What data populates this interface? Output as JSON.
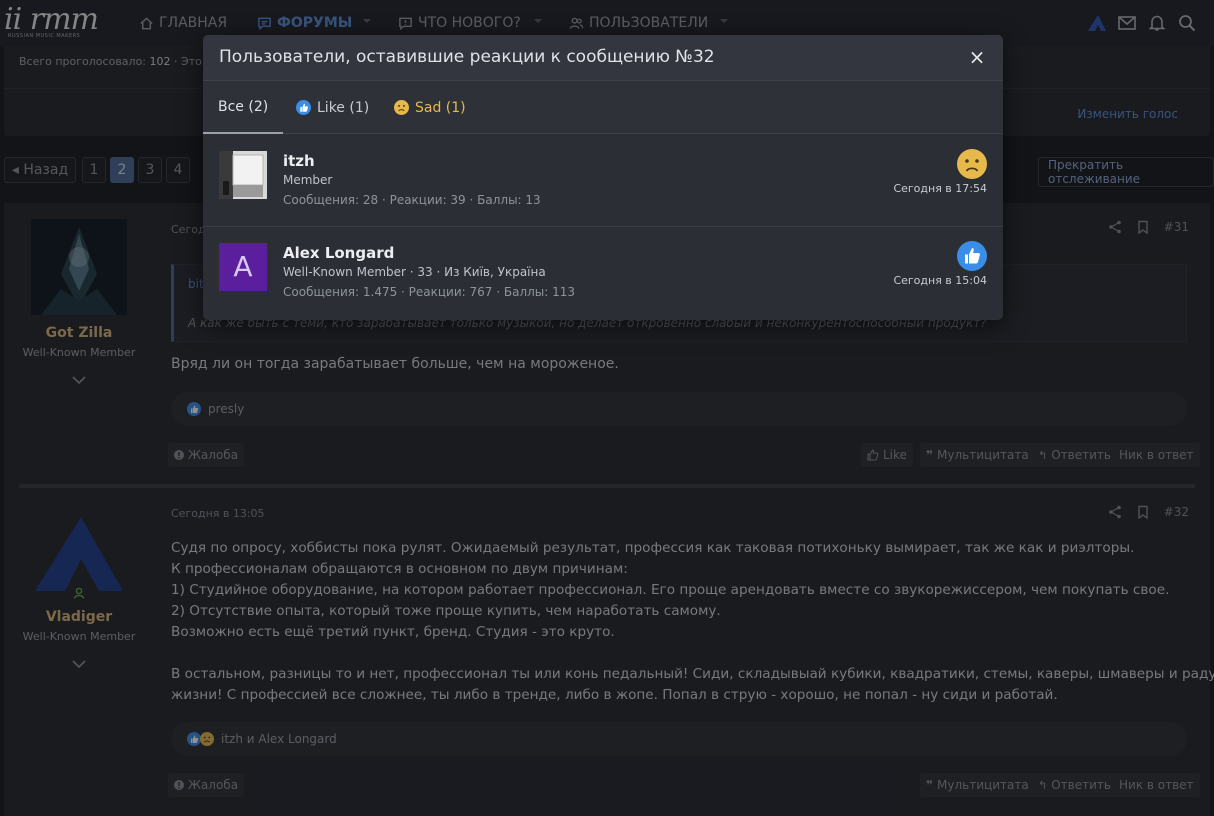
{
  "nav": {
    "logo_text": "ii rmm",
    "logo_sub": "RUSSIAN MUSIC MAKERS",
    "items": [
      {
        "label": "ГЛАВНАЯ"
      },
      {
        "label": "ФОРУМЫ"
      },
      {
        "label": "ЧТО НОВОГО?"
      },
      {
        "label": "ПОЛЬЗОВАТЕЛИ"
      }
    ]
  },
  "poll": {
    "total_label": "Всего проголосовало:",
    "total_value": "102",
    "total_suffix": "· Это",
    "change_vote": "Изменить голос"
  },
  "pager": {
    "prev": "◂ Назад",
    "pages": [
      "1",
      "2",
      "3",
      "4"
    ],
    "current": "2",
    "unwatch": "Прекратить отслеживание"
  },
  "posts": [
    {
      "author": "Got Zilla",
      "author_title": "Well-Known Member",
      "date": "Сегодня в",
      "number": "#31",
      "quote_head": "bit",
      "quote_text": "А как же быть с теми, кто зарабатывает только музыкой, но делает откровенно слабый и неконкурентоспособный продукт?",
      "text": [
        "Вряд ли он тогда зарабатывает больше, чем на мороженое."
      ],
      "reactions_text": "presly",
      "report": "Жалоба",
      "like": "Like",
      "multiquote": "Мультицитата",
      "reply": "Ответить",
      "nick": "Ник в ответ"
    },
    {
      "author": "Vladiger",
      "author_title": "Well-Known Member",
      "date": "Сегодня в 13:05",
      "number": "#32",
      "text": [
        "Судя по опросу, хоббисты пока рулят. Ожидаемый результат, профессия как таковая потихоньку вымирает, так же как и риэлторы.",
        "К профессионалам обращаются в основном по двум причинам:",
        "1) Студийное оборудование, на котором работает профессионал. Его проще арендовать вместе со звукорежиссером, чем покупать свое.",
        "2) Отсутствие опыта, который тоже проще купить, чем наработать самому.",
        "Возможно есть ещё третий пункт, бренд. Студия - это круто.",
        "",
        "В остальном, разницы то и нет, профессионал ты или конь педальный! Сиди, складывыай кубики, квадратики, стемы, каверы, шмаверы и радуйся",
        "жизни! С профессией все сложнее, ты либо в тренде, либо в жопе. Попал в струю - хорошо, не попал - ну сиди и работай."
      ],
      "reactions_text": "itzh и Alex Longard",
      "report": "Жалоба",
      "multiquote": "Мультицитата",
      "reply": "Ответить",
      "nick": "Ник в ответ"
    }
  ],
  "modal": {
    "title": "Пользователи, оставившие реакции к сообщению №32",
    "close": "×",
    "tabs": [
      {
        "label": "Все (2)"
      },
      {
        "label": "Like (1)"
      },
      {
        "label": "Sad (1)"
      }
    ],
    "rows": [
      {
        "name": "itzh",
        "title": "Member",
        "stats": "Сообщения: 28 · Реакции: 39 · Баллы: 13",
        "time": "Сегодня в 17:54",
        "reaction_icon": "sad-icon"
      },
      {
        "name": "Alex Longard",
        "title": "Well-Known Member · 33 · Из Київ, Україна",
        "stats": "Сообщения: 1.475 · Реакции: 767 · Баллы: 113",
        "time": "Сегодня в 15:04",
        "avatar_letter": "A",
        "reaction_icon": "like-icon"
      }
    ]
  },
  "colors": {
    "accent": "#5d8fd9",
    "author_name": "#d9b67a",
    "sad": "#e6b94a",
    "like": "#3b8ee8",
    "avatar_purple": "#5b1f9e"
  }
}
